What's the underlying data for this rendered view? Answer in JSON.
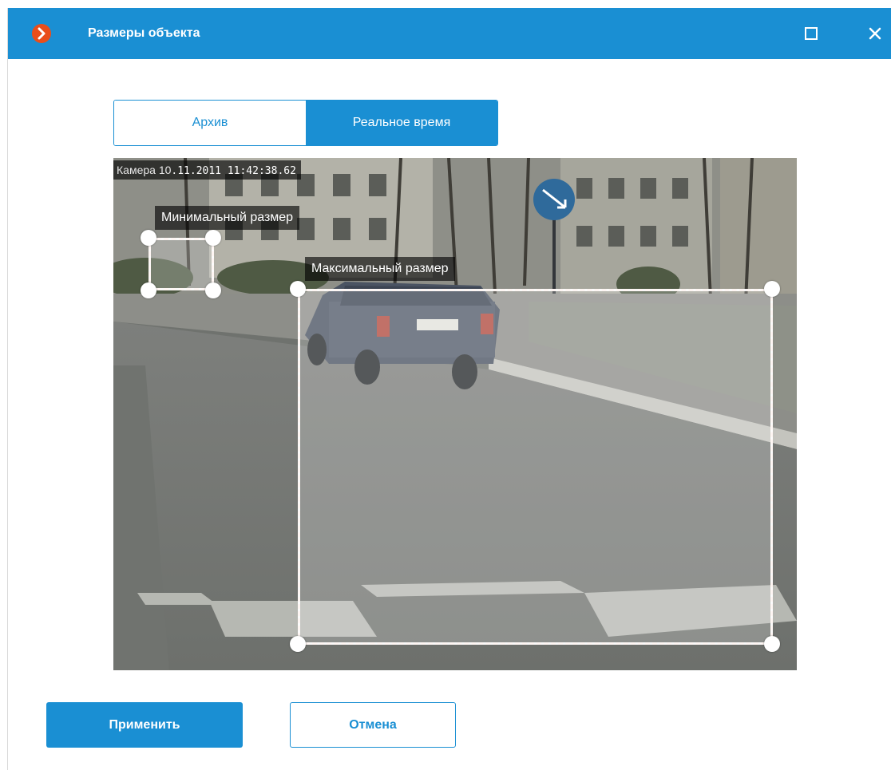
{
  "window": {
    "title": "Размеры объекта",
    "accent_color": "#1a8fd3",
    "brand_color": "#e94e1b",
    "icons": [
      "app-logo-icon",
      "maximize-icon",
      "close-icon"
    ]
  },
  "tabs": [
    {
      "label": "Архив",
      "active": false
    },
    {
      "label": "Реальное время",
      "active": true
    }
  ],
  "video": {
    "camera_name": "Камера 10",
    "timestamp": ".11.2011 11:42:38.62",
    "min_zone_label": "Минимальный размер",
    "max_zone_label": "Максимальный размер",
    "zone_border_colors": [
      "#e94e1b",
      "#ffffff"
    ]
  },
  "buttons": {
    "apply": "Применить",
    "cancel": "Отмена"
  }
}
